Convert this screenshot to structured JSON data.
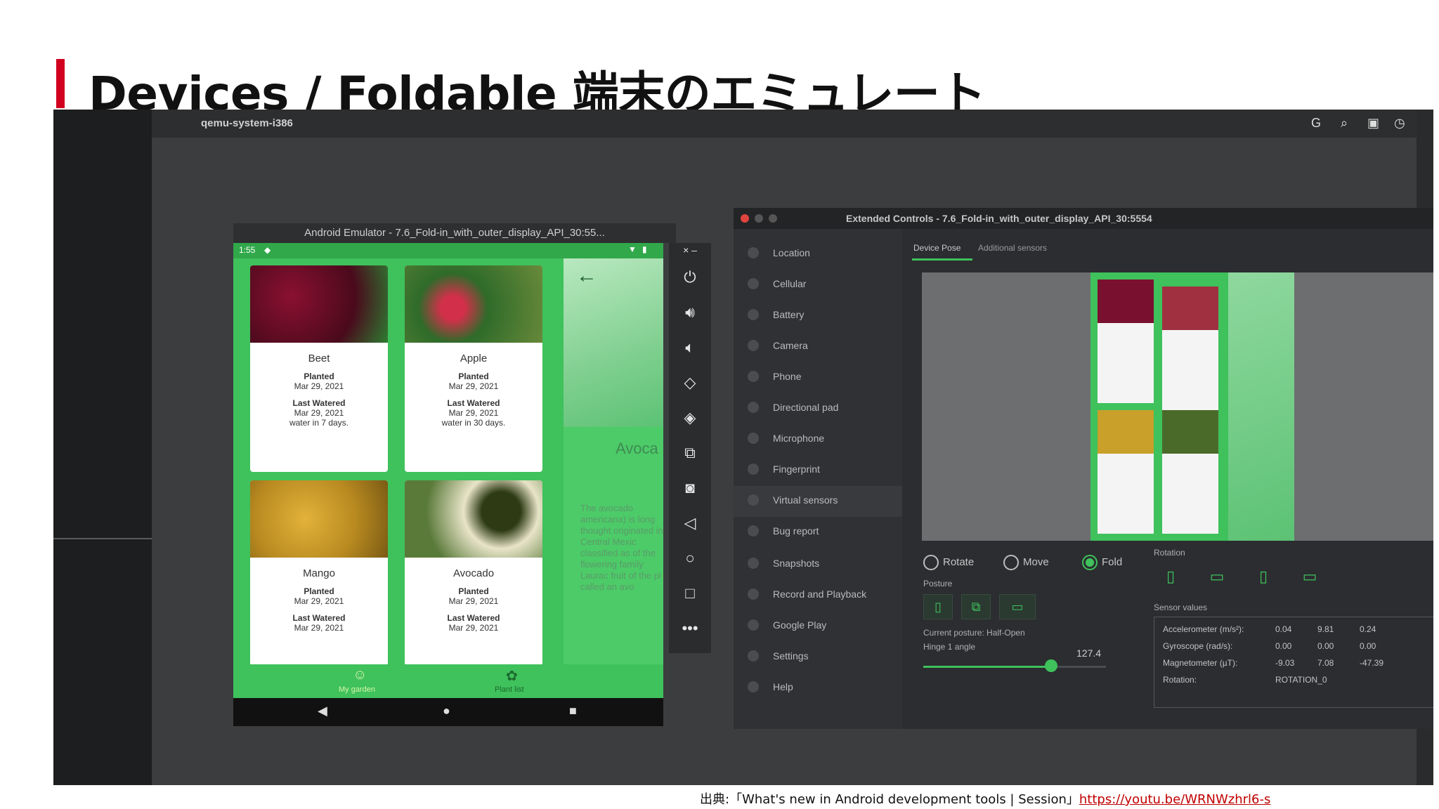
{
  "slide": {
    "title": "Devices / Foldable 端末のエミュレート"
  },
  "desktop": {
    "app_name": "qemu-system-i386"
  },
  "emulator": {
    "title": "Android Emulator - 7.6_Fold-in_with_outer_display_API_30:55...",
    "status_time": "1:55",
    "cards": [
      {
        "name": "Beet",
        "planted_label": "Planted",
        "planted": "Mar 29, 2021",
        "watered_label": "Last Watered",
        "watered": "Mar 29, 2021",
        "note": "water in 7 days."
      },
      {
        "name": "Apple",
        "planted_label": "Planted",
        "planted": "Mar 29, 2021",
        "watered_label": "Last Watered",
        "watered": "Mar 29, 2021",
        "note": "water in 30 days."
      },
      {
        "name": "Mango",
        "planted_label": "Planted",
        "planted": "Mar 29, 2021",
        "watered_label": "Last Watered",
        "watered": "Mar 29, 2021",
        "note": ""
      },
      {
        "name": "Avocado",
        "planted_label": "Planted",
        "planted": "Mar 29, 2021",
        "watered_label": "Last Watered",
        "watered": "Mar 29, 2021",
        "note": ""
      }
    ],
    "detail": {
      "title": "Avoca",
      "text": "The avocado americana) is long thought originated in Central Mexic classified as of the flowering family Laurac fruit of the pl called an avo"
    },
    "bottom_tabs": [
      "My garden",
      "Plant list"
    ]
  },
  "extended": {
    "title": "Extended Controls - 7.6_Fold-in_with_outer_display_API_30:5554",
    "sidebar": [
      "Location",
      "Cellular",
      "Battery",
      "Camera",
      "Phone",
      "Directional pad",
      "Microphone",
      "Fingerprint",
      "Virtual sensors",
      "Bug report",
      "Snapshots",
      "Record and Playback",
      "Google Play",
      "Settings",
      "Help"
    ],
    "tabs": [
      "Device Pose",
      "Additional sensors"
    ],
    "modes": {
      "rotate": "Rotate",
      "move": "Move",
      "fold": "Fold",
      "selected": "Fold"
    },
    "posture_label": "Posture",
    "current_posture": "Current posture: Half-Open",
    "hinge_label": "Hinge 1 angle",
    "hinge_value": "127.4",
    "hinge_fraction": 0.7,
    "rotation_label": "Rotation",
    "sensor_label": "Sensor values",
    "sensors": [
      {
        "name": "Accelerometer (m/s²):",
        "a": "0.04",
        "b": "9.81",
        "c": "0.24"
      },
      {
        "name": "Gyroscope (rad/s):",
        "a": "0.00",
        "b": "0.00",
        "c": "0.00"
      },
      {
        "name": "Magnetometer (µT):",
        "a": "-9.03",
        "b": "7.08",
        "c": "-47.39"
      },
      {
        "name": "Rotation:",
        "a": "ROTATION_0",
        "b": "",
        "c": ""
      }
    ]
  },
  "footer": {
    "prefix": "出典:「What's new in Android development tools | Session」",
    "link": "https://youtu.be/WRNWzhrl6-s"
  },
  "colors": {
    "accent_red": "#d1001f",
    "android_green": "#3fc15c"
  }
}
